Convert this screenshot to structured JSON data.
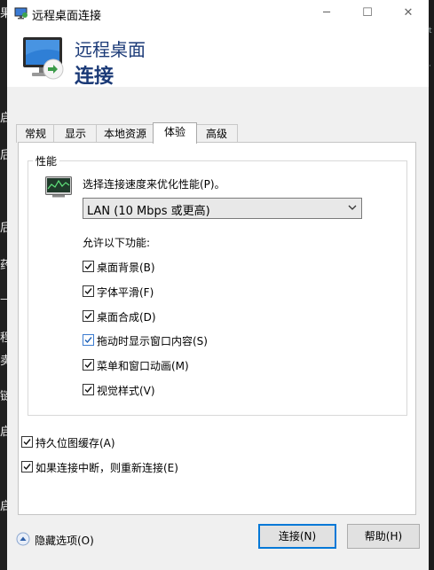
{
  "window": {
    "title": "远程桌面连接",
    "buttons": {
      "minimize": "─",
      "maximize": "☐",
      "close": "✕"
    }
  },
  "banner": {
    "line1": "远程桌面",
    "line2": "连接"
  },
  "tabs": [
    {
      "label": "常规"
    },
    {
      "label": "显示"
    },
    {
      "label": "本地资源"
    },
    {
      "label": "体验",
      "active": true
    },
    {
      "label": "高级"
    }
  ],
  "performance": {
    "group_title": "性能",
    "prompt": "选择连接速度来优化性能(P)。",
    "speed_select": {
      "value": "LAN (10 Mbps 或更高)"
    },
    "allow_label": "允许以下功能:",
    "features": [
      {
        "label": "桌面背景(B)",
        "checked": true
      },
      {
        "label": "字体平滑(F)",
        "checked": true
      },
      {
        "label": "桌面合成(D)",
        "checked": true
      },
      {
        "label": "拖动时显示窗口内容(S)",
        "checked": true
      },
      {
        "label": "菜单和窗口动画(M)",
        "checked": true
      },
      {
        "label": "视觉样式(V)",
        "checked": true
      }
    ]
  },
  "options": [
    {
      "label": "持久位图缓存(A)",
      "checked": true
    },
    {
      "label": "如果连接中断，则重新连接(E)",
      "checked": true
    }
  ],
  "footer": {
    "hide_options": "隐藏选项(O)",
    "connect": "连接(N)",
    "help": "帮助(H)"
  },
  "background": {
    "left_glyphs": [
      "果",
      "启",
      "后",
      "后",
      "药",
      "—",
      "程",
      "卖",
      "链",
      "启",
      "启"
    ],
    "right_glyphs": [
      "t",
      "·"
    ]
  }
}
